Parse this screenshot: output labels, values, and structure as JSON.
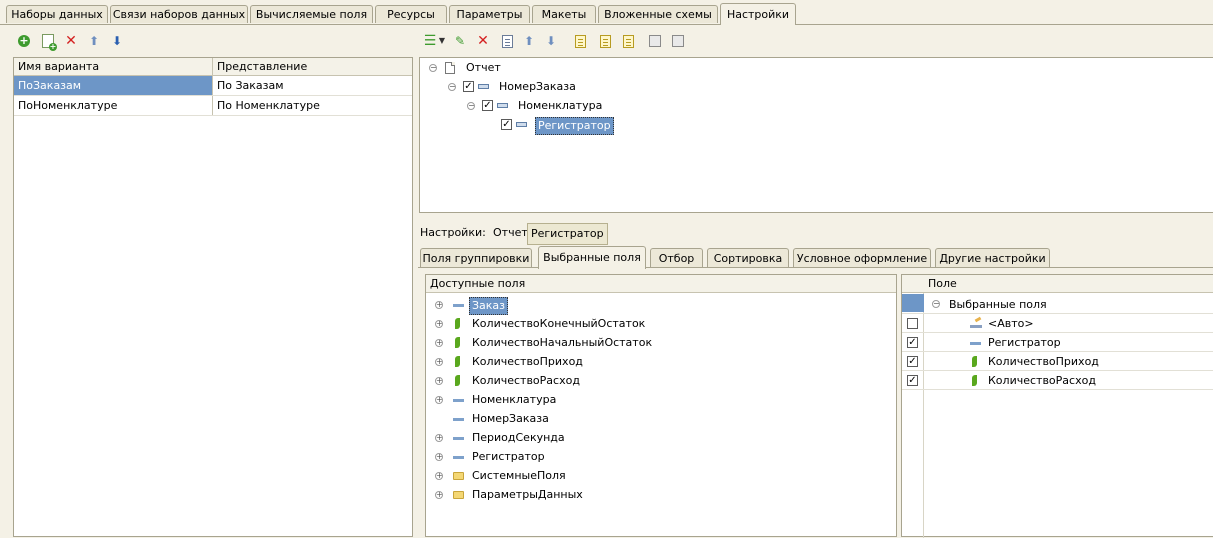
{
  "top_tabs": [
    {
      "label": "Наборы данных"
    },
    {
      "label": "Связи наборов данных"
    },
    {
      "label": "Вычисляемые поля"
    },
    {
      "label": "Ресурсы"
    },
    {
      "label": "Параметры"
    },
    {
      "label": "Макеты"
    },
    {
      "label": "Вложенные схемы"
    },
    {
      "label": "Настройки",
      "active": true
    }
  ],
  "variants": {
    "columns": [
      "Имя варианта",
      "Представление"
    ],
    "rows": [
      {
        "name": "ПоЗаказам",
        "presentation": "По Заказам",
        "selected": true
      },
      {
        "name": "ПоНоменклатуре",
        "presentation": "По Номенклатуре"
      }
    ]
  },
  "structure_tree": [
    {
      "label": "Отчет",
      "icon": "report-icon"
    },
    {
      "label": "НомерЗаказа",
      "icon": "grouping-icon",
      "checked": true
    },
    {
      "label": "Номенклатура",
      "icon": "grouping-icon",
      "checked": true
    },
    {
      "label": "Регистратор",
      "icon": "grouping-icon",
      "checked": true,
      "selected": true
    }
  ],
  "settings_path": {
    "label": "Настройки:",
    "items": [
      "Отчет",
      "Регистратор"
    ]
  },
  "settings_tabs": [
    {
      "label": "Поля группировки"
    },
    {
      "label": "Выбранные поля",
      "active": true
    },
    {
      "label": "Отбор"
    },
    {
      "label": "Сортировка"
    },
    {
      "label": "Условное оформление"
    },
    {
      "label": "Другие настройки"
    }
  ],
  "available_fields": {
    "header": "Доступные поля",
    "items": [
      {
        "label": "Заказ",
        "icon": "field-icon",
        "expandable": true,
        "selected": true
      },
      {
        "label": "КоличествоКонечныйОстаток",
        "icon": "resource-icon",
        "expandable": true
      },
      {
        "label": "КоличествоНачальныйОстаток",
        "icon": "resource-icon",
        "expandable": true
      },
      {
        "label": "КоличествоПриход",
        "icon": "resource-icon",
        "expandable": true
      },
      {
        "label": "КоличествоРасход",
        "icon": "resource-icon",
        "expandable": true
      },
      {
        "label": "Номенклатура",
        "icon": "field-icon",
        "expandable": true
      },
      {
        "label": "НомерЗаказа",
        "icon": "field-icon",
        "expandable": false
      },
      {
        "label": "ПериодСекунда",
        "icon": "field-icon",
        "expandable": true
      },
      {
        "label": "Регистратор",
        "icon": "field-icon",
        "expandable": true
      },
      {
        "label": "СистемныеПоля",
        "icon": "folder-icon",
        "expandable": true
      },
      {
        "label": "ПараметрыДанных",
        "icon": "folder-icon",
        "expandable": true
      }
    ]
  },
  "selected_fields": {
    "header": "Поле",
    "root": "Выбранные поля",
    "items": [
      {
        "label": "<Авто>",
        "icon": "auto-icon",
        "checked": false
      },
      {
        "label": "Регистратор",
        "icon": "field-icon",
        "checked": true
      },
      {
        "label": "КоличествоПриход",
        "icon": "resource-icon",
        "checked": true
      },
      {
        "label": "КоличествоРасход",
        "icon": "resource-icon",
        "checked": true
      }
    ]
  },
  "colors": {
    "selection": "#6d96c7",
    "background": "#f4f1e6",
    "resource": "#5aa81e"
  }
}
